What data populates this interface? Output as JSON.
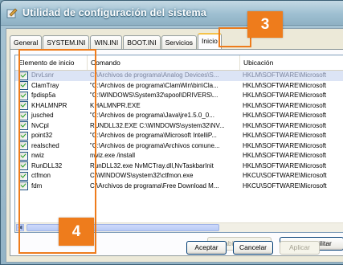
{
  "window": {
    "title": "Utilidad de configuración del sistema"
  },
  "tabs": [
    {
      "label": "General"
    },
    {
      "label": "SYSTEM.INI"
    },
    {
      "label": "WIN.INI"
    },
    {
      "label": "BOOT.INI"
    },
    {
      "label": "Servicios"
    },
    {
      "label": "Inicio"
    }
  ],
  "active_tab": "Inicio",
  "list": {
    "columns": [
      "Elemento de inicio",
      "Comando",
      "Ubicación"
    ],
    "rows": [
      {
        "item": "DrvLsnr",
        "command": "C:\\Archivos de programa\\Analog Devices\\S...",
        "location": "HKLM\\SOFTWARE\\Microsoft",
        "checked": true,
        "selected": true
      },
      {
        "item": "ClamTray",
        "command": "\"C:\\Archivos de programa\\ClamWin\\bin\\Cla...",
        "location": "HKLM\\SOFTWARE\\Microsoft",
        "checked": true,
        "selected": false
      },
      {
        "item": "fpdisp5a",
        "command": "\"C:\\WINDOWS\\System32\\spool\\DRIVERS\\...",
        "location": "HKLM\\SOFTWARE\\Microsoft",
        "checked": true,
        "selected": false
      },
      {
        "item": "KHALMNPR",
        "command": "KHALMNPR.EXE",
        "location": "HKLM\\SOFTWARE\\Microsoft",
        "checked": true,
        "selected": false
      },
      {
        "item": "jusched",
        "command": "\"C:\\Archivos de programa\\Java\\jre1.5.0_0...",
        "location": "HKLM\\SOFTWARE\\Microsoft",
        "checked": true,
        "selected": false
      },
      {
        "item": "NvCpl",
        "command": "RUNDLL32.EXE C:\\WINDOWS\\system32\\NV...",
        "location": "HKLM\\SOFTWARE\\Microsoft",
        "checked": true,
        "selected": false
      },
      {
        "item": "point32",
        "command": "\"C:\\Archivos de programa\\Microsoft IntelliP...",
        "location": "HKLM\\SOFTWARE\\Microsoft",
        "checked": true,
        "selected": false
      },
      {
        "item": "realsched",
        "command": "\"C:\\Archivos de programa\\Archivos comune...",
        "location": "HKLM\\SOFTWARE\\Microsoft",
        "checked": true,
        "selected": false
      },
      {
        "item": "nwiz",
        "command": "nwiz.exe /install",
        "location": "HKLM\\SOFTWARE\\Microsoft",
        "checked": true,
        "selected": false
      },
      {
        "item": "RunDLL32",
        "command": "RunDLL32.exe NvMCTray.dll,NvTaskbarInit",
        "location": "HKLM\\SOFTWARE\\Microsoft",
        "checked": true,
        "selected": false
      },
      {
        "item": "ctfmon",
        "command": "C:\\WINDOWS\\system32\\ctfmon.exe",
        "location": "HKCU\\SOFTWARE\\Microsoft",
        "checked": true,
        "selected": false
      },
      {
        "item": "fdm",
        "command": "C:\\Archivos de programa\\Free Download M...",
        "location": "HKCU\\SOFTWARE\\Microsoft",
        "checked": true,
        "selected": false
      }
    ]
  },
  "buttons": {
    "enable_all": "Habilitar todo",
    "disable_all": "Deshabilitar",
    "accept": "Aceptar",
    "cancel": "Cancelar",
    "apply": "Aplicar"
  },
  "annotations": {
    "badge_tab": "3",
    "badge_list": "4",
    "color": "#ee7c1c"
  }
}
